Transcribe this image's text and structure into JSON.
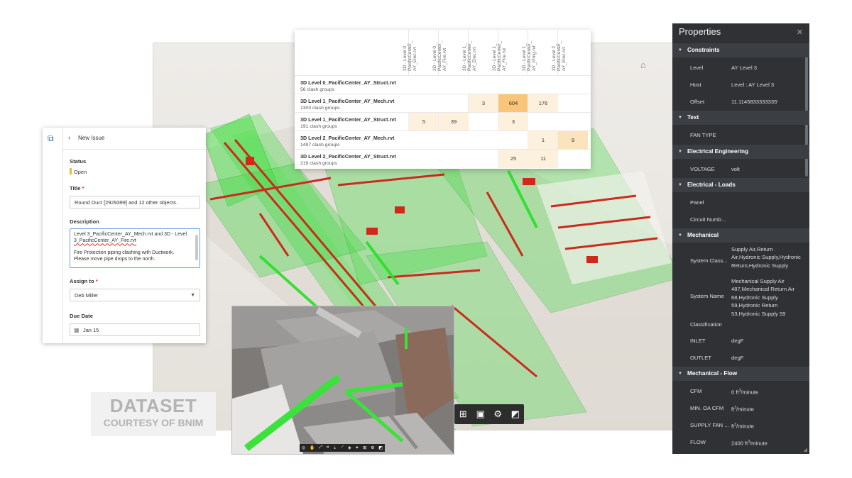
{
  "viewport": {
    "home_icon": "home-icon",
    "toolbar_icons": [
      "model-tree-icon",
      "save-icon",
      "settings-icon",
      "fullscreen-icon"
    ]
  },
  "clash_matrix": {
    "columns": [
      "3D - Level 0_\nPacificCenter_\nAY_Elec.rvt",
      "3D - Level 0_\nPacificCenter_\nAY_Fire.rvt",
      "3D - Level 1_\nPacificCenter_\nAY_Elec.rvt",
      "3D - Level 1_\nPacificCenter_\nAY_Fire.rvt",
      "3D - Level 1_\nPacificCenter_\nAY_Plmg.rvt",
      "3D - Level 2_\nPacificCenter_\nAY_Elec.rvt"
    ],
    "rows": [
      {
        "name": "3D Level 0_PacificCenter_AY_Struct.rvt",
        "groups": "56 clash groups",
        "cells": [
          "",
          "",
          "",
          "",
          "",
          ""
        ]
      },
      {
        "name": "3D Level 1_PacificCenter_AY_Mech.rvt",
        "groups": "1300 clash groups",
        "cells": [
          "",
          "",
          "3",
          "604",
          "176",
          ""
        ]
      },
      {
        "name": "3D Level 1_PacificCenter_AY_Struct.rvt",
        "groups": "191 clash groups",
        "cells": [
          "5",
          "39",
          "",
          "3",
          "",
          ""
        ]
      },
      {
        "name": "3D Level 2_PacificCenter_AY_Mech.rvt",
        "groups": "1497 clash groups",
        "cells": [
          "",
          "",
          "",
          "",
          "1",
          "9"
        ]
      },
      {
        "name": "3D Level 2_PacificCenter_AY_Struct.rvt",
        "groups": "219 clash groups",
        "cells": [
          "",
          "",
          "",
          "25",
          "11",
          ""
        ]
      }
    ],
    "heat": {
      "high": "#f9c57a",
      "mid": "#fbe3bd",
      "low": "#fdf1de"
    }
  },
  "issue": {
    "header": "New Issue",
    "status_label": "Status",
    "status_value": "Open",
    "status_color": "#f3b53e",
    "title_label": "Title",
    "title_value": "Round Duct [2929399] and 12 other objects.",
    "description_label": "Description",
    "description_line1": "Level 3_PacificCenter_AY_Mech.rvt and 3D - Level",
    "description_line2": "3_PacificCenter_AY_Fire.rvt",
    "description_line3": "Fire Protection piping clashing with Ductwork.",
    "description_line4": "Please move pipe drops to the north.",
    "assign_label": "Assign to",
    "assign_value": "Deb Miller",
    "due_label": "Due Date",
    "due_value": "Jan 15"
  },
  "badge": {
    "line1": "DATASET",
    "line2": "COURTESY OF BNIM"
  },
  "properties": {
    "title": "Properties",
    "sections": {
      "constraints": "Constraints",
      "text": "Text",
      "electrical_engineering": "Electrical Engineering",
      "electrical_loads": "Electrical - Loads",
      "mechanical": "Mechanical",
      "mechanical_flow": "Mechanical - Flow"
    },
    "rows": {
      "level_k": "Level",
      "level_v": "AY Level 3",
      "host_k": "Host",
      "host_v": "Level : AY Level 3",
      "offset_k": "Offset",
      "offset_v": "11.1145833333335'",
      "fan_type_k": "FAN TYPE",
      "voltage_k": "VOLTAGE",
      "voltage_v": "volt",
      "panel_k": "Panel",
      "circuit_k": "Circuit Numb...",
      "system_class_k": "System Class...",
      "system_class_v": "Supply Air,Return Air,Hydronic Supply,Hydronic Return,Hydronic Supply",
      "system_name_k": "System Name",
      "system_name_v": "Mechanical Supply Air 487,Mechanical Return Air 68,Hydronic Supply 59,Hydronic Return 53,Hydronic Supply 59",
      "classification_k": "Classification",
      "inlet_k": "INLET",
      "inlet_v": "degF",
      "outlet_k": "OUTLET",
      "outlet_v": "degF",
      "cfm_k": "CFM",
      "cfm_v": "0 ft",
      "min_oa_k": "MIN. OA CFM",
      "min_oa_v": "ft",
      "supply_fan_k": "SUPPLY FAN ...",
      "supply_fan_v": "ft",
      "flow_k": "FLOW",
      "flow_v": "2400 ft",
      "flow_unit_sup": "3",
      "flow_unit_tail": "/minute"
    }
  }
}
